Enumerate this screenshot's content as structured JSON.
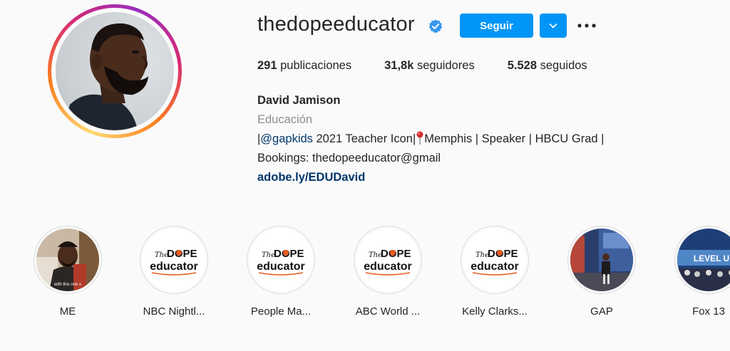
{
  "profile": {
    "username": "thedopeeducator",
    "verified": true,
    "follow_label": "Seguir",
    "accent_color": "#0095f6"
  },
  "stats": {
    "posts_count": "291",
    "posts_label": "publicaciones",
    "followers_count": "31,8k",
    "followers_label": "seguidores",
    "following_count": "5.528",
    "following_label": "seguidos"
  },
  "bio": {
    "name": "David Jamison",
    "category": "Educación",
    "line1_prefix": "|",
    "mention": "@gapkids",
    "line1_mid": " 2021 Teacher Icon|",
    "line1_suffix": "Memphis | Speaker | HBCU Grad |",
    "line2": "Bookings: thedopeeducator@gmail",
    "link": "adobe.ly/EDUDavid"
  },
  "highlights": [
    {
      "label": "ME",
      "icon": "portrait-photo"
    },
    {
      "label": "NBC Nightl...",
      "icon": "dope-educator-logo"
    },
    {
      "label": "People Ma...",
      "icon": "dope-educator-logo"
    },
    {
      "label": "ABC World ...",
      "icon": "dope-educator-logo"
    },
    {
      "label": "Kelly Clarks...",
      "icon": "dope-educator-logo"
    },
    {
      "label": "GAP",
      "icon": "stage-photo"
    },
    {
      "label": "Fox 13",
      "icon": "level-up-photo"
    }
  ],
  "logo_text": {
    "the": "The",
    "dope": "DOPE",
    "educator": "educator"
  }
}
